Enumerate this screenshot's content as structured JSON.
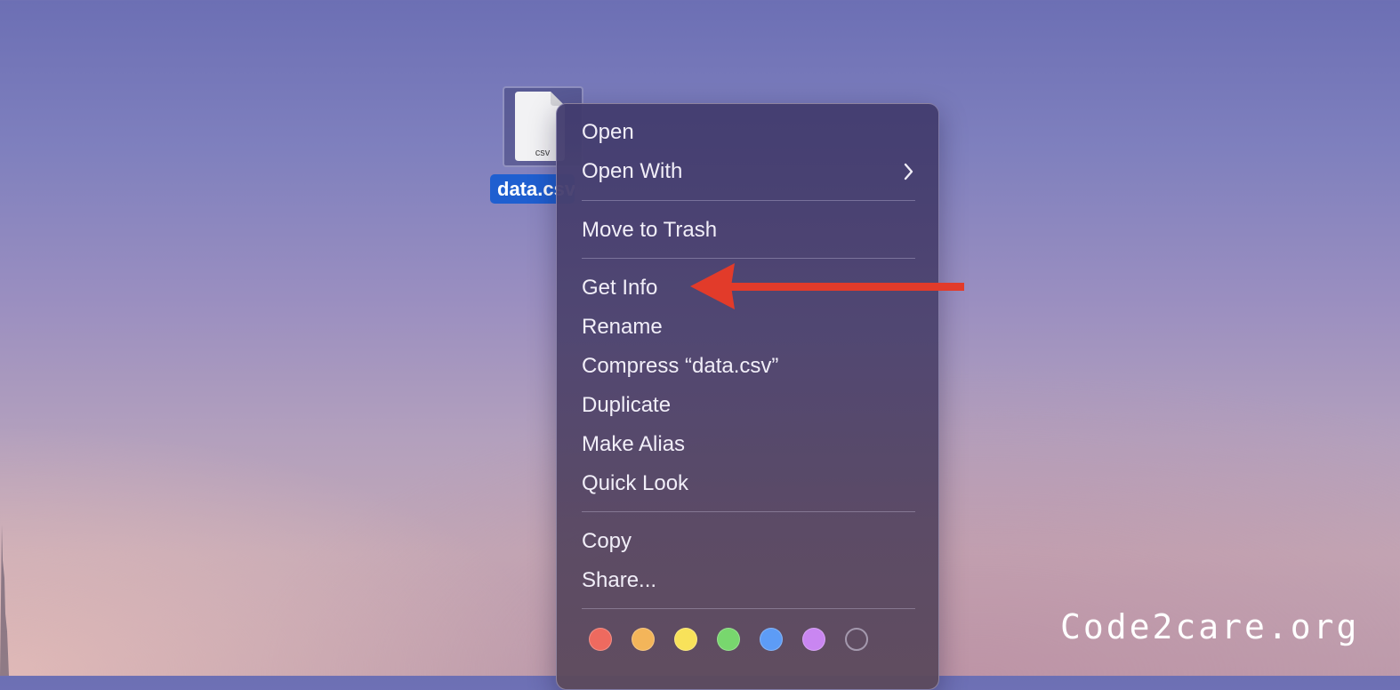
{
  "desktop_file": {
    "icon": "csv-document-icon",
    "extension_label": "csv",
    "name_label": "data.csv"
  },
  "context_menu": {
    "groups": [
      {
        "items": [
          {
            "label": "Open",
            "has_submenu": false
          },
          {
            "label": "Open With",
            "has_submenu": true
          }
        ]
      },
      {
        "items": [
          {
            "label": "Move to Trash",
            "has_submenu": false
          }
        ]
      },
      {
        "items": [
          {
            "label": "Get Info",
            "has_submenu": false
          },
          {
            "label": "Rename",
            "has_submenu": false
          },
          {
            "label": "Compress “data.csv”",
            "has_submenu": false
          },
          {
            "label": "Duplicate",
            "has_submenu": false
          },
          {
            "label": "Make Alias",
            "has_submenu": false
          },
          {
            "label": "Quick Look",
            "has_submenu": false
          }
        ]
      },
      {
        "items": [
          {
            "label": "Copy",
            "has_submenu": false
          },
          {
            "label": "Share...",
            "has_submenu": false
          }
        ]
      }
    ],
    "tag_colors": [
      {
        "name": "red",
        "color": "#ee6a5f"
      },
      {
        "name": "orange",
        "color": "#f3b55a"
      },
      {
        "name": "yellow",
        "color": "#f8e25a"
      },
      {
        "name": "green",
        "color": "#78d76e"
      },
      {
        "name": "blue",
        "color": "#5d9cf6"
      },
      {
        "name": "purple",
        "color": "#c986f1"
      },
      {
        "name": "none",
        "color": "transparent"
      }
    ]
  },
  "annotation": {
    "arrow_color": "#e23b2a",
    "points_to": "Get Info"
  },
  "watermark": {
    "text": "Code2care.org"
  }
}
